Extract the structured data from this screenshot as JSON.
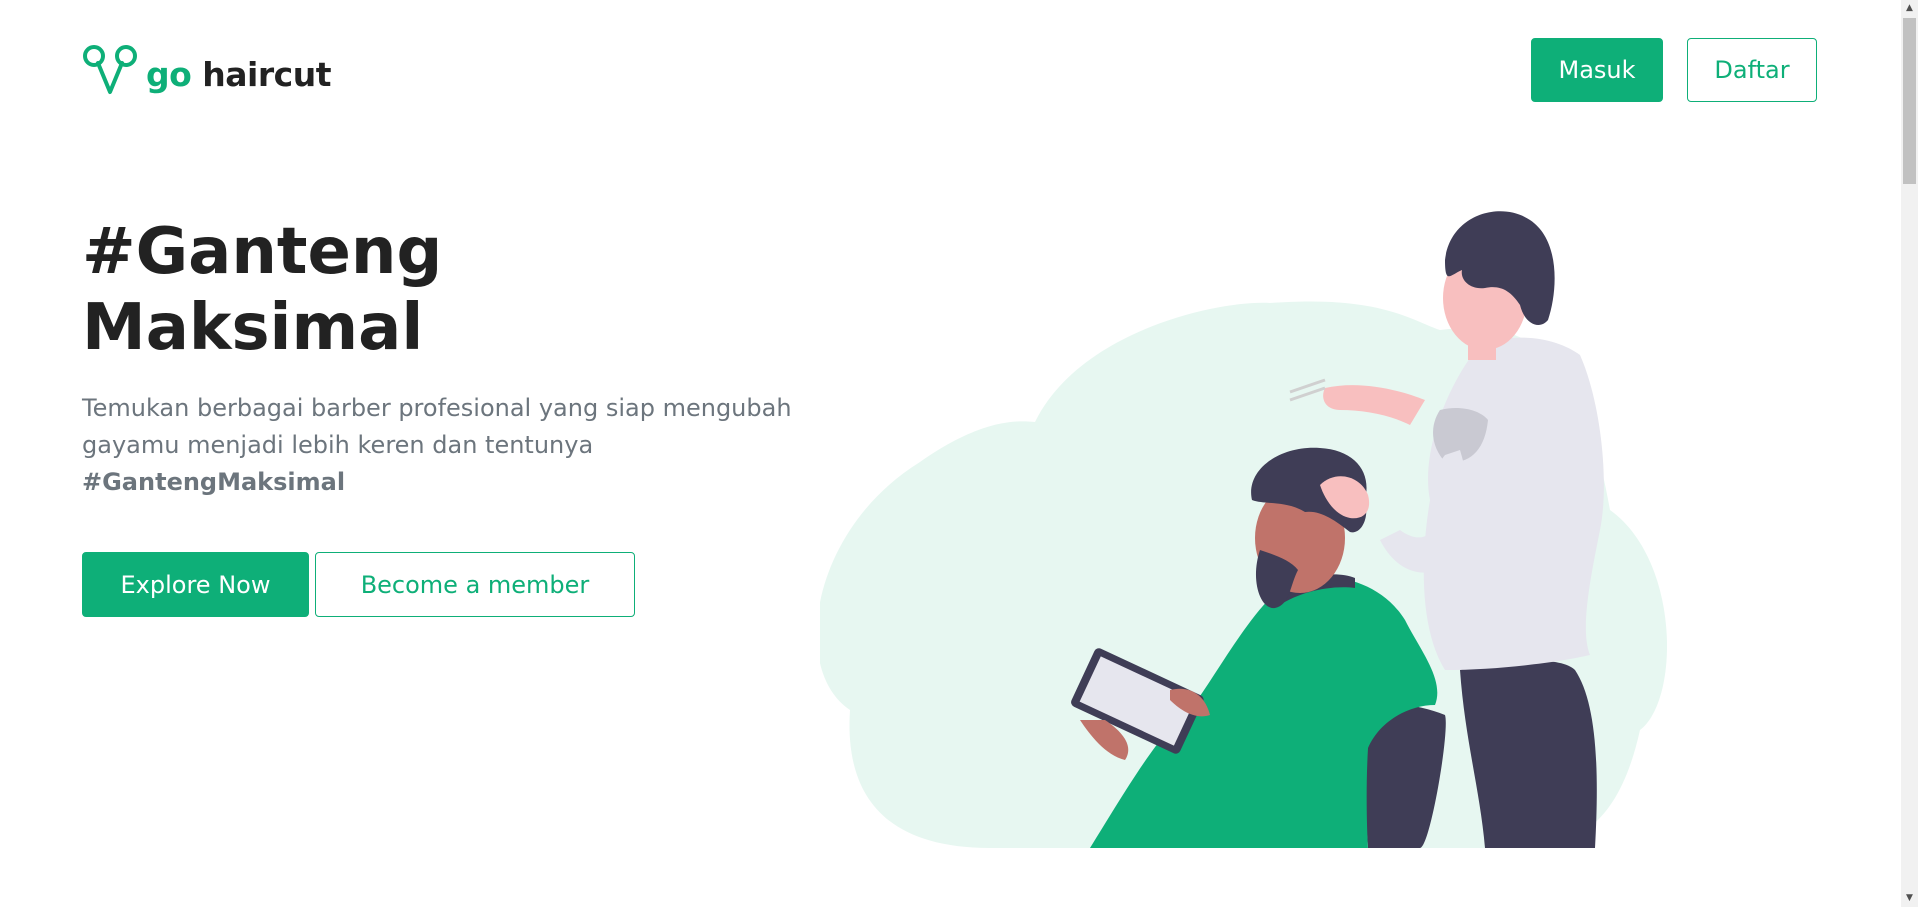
{
  "brand": {
    "logo_go": "go",
    "logo_name": "haircut",
    "logo_icon": "scissors-icon",
    "primary_color": "#0eaf78"
  },
  "header": {
    "login_label": "Masuk",
    "register_label": "Daftar"
  },
  "hero": {
    "title_line1": "#Ganteng",
    "title_line2": "Maksimal",
    "description": "Temukan berbagai barber profesional yang siap mengubah gayamu menjadi lebih keren dan tentunya",
    "hashtag": "#GantengMaksimal",
    "explore_label": "Explore Now",
    "member_label": "Become a member"
  },
  "scrollbar": {
    "up_icon": "▲",
    "down_icon": "▼"
  }
}
